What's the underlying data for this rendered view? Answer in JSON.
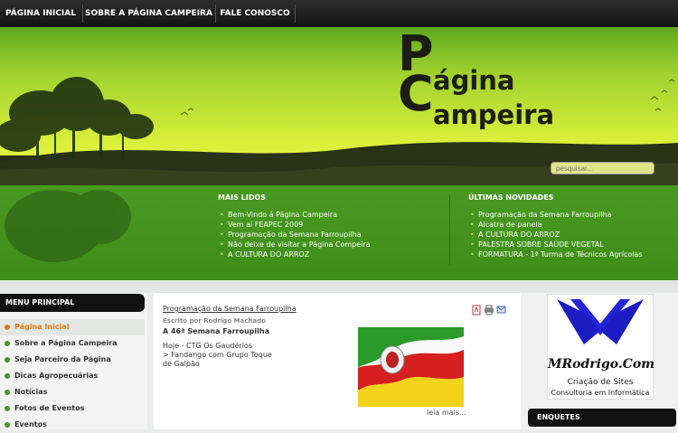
{
  "nav": {
    "items": [
      "PÁGINA INICIAL",
      "SOBRE A PÁGINA CAMPEIRA",
      "FALE CONOSCO"
    ]
  },
  "logo": {
    "initial_p": "P",
    "initial_c": "C",
    "line1": "ágina",
    "line2": "ampeira"
  },
  "search": {
    "placeholder": "pesquisar..."
  },
  "mais_lidos": {
    "title": "MAIS LIDOS",
    "items": [
      "Bem-Vindo á Página Campeira",
      "Vem aí FEAPEC 2009",
      "Programação da Semana Farroupilha",
      "Não deixe de visitar a Página Compeira",
      "A CULTURA DO ARROZ"
    ]
  },
  "ultimas": {
    "title": "ÚLTIMAS NOVIDADES",
    "items": [
      "Programação da Semana Farroupilha",
      "Alcatra de panela",
      "A CULTURA DO ARROZ",
      "PALESTRA SOBRE SAÚDE VEGETAL",
      "FORMATURA - 1ª Turma de Técnicos Agrícolas"
    ]
  },
  "menu": {
    "title": "MENU PRINCIPAL",
    "items": [
      "Página Inicial",
      "Sobre a Página Campeira",
      "Seja Parceiro da Página",
      "Dicas Agropecuárias",
      "Notícias",
      "Fotos de Eventos",
      "Eventos"
    ],
    "active_color": "#e07a10"
  },
  "article": {
    "link": "Programação da Semana Farroupilha",
    "author": "Escrito por Rodrigo Machado",
    "title": "A 46ª Semana Farroupilha",
    "text_line1": "Hoje - CTG Os Gaudérios",
    "text_line2": "> Fandango com Grupo Toque",
    "text_line3": "de Galpão",
    "read_more": "leia mais…"
  },
  "ad": {
    "name": "MRodrigo.Com",
    "line1": "Criação de Sites",
    "line2": "Consultoria em Informática"
  },
  "polls": {
    "title": "ENQUETES"
  }
}
